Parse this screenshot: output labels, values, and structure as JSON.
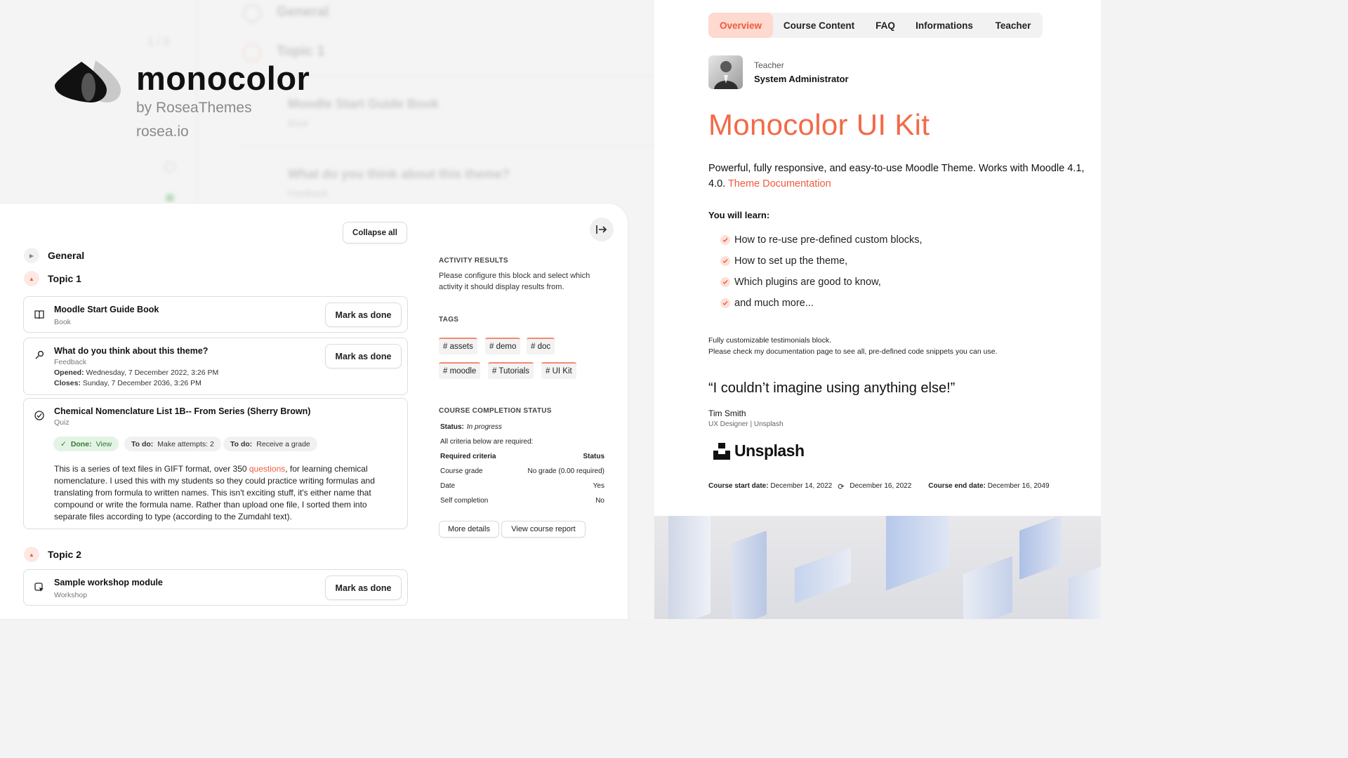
{
  "brand": {
    "name": "monocolor",
    "by": "by RoseaThemes",
    "site": "rosea.io"
  },
  "background_ghost": {
    "section_general": "General",
    "section_topic1": "Topic 1",
    "book_title": "Moodle Start Guide Book",
    "book_type": "Book",
    "feedback_title": "What do you think about this theme?",
    "feedback_type": "Feedback",
    "counter": "1 / 3"
  },
  "course_panel": {
    "collapse_all": "Collapse all",
    "sections": [
      {
        "title": "General"
      },
      {
        "title": "Topic 1"
      },
      {
        "title": "Topic 2"
      }
    ],
    "activities": [
      {
        "title": "Moodle Start Guide Book",
        "type": "Book",
        "button": "Mark as done",
        "icon": "book-icon"
      },
      {
        "title": "What do you think about this theme?",
        "type": "Feedback",
        "button": "Mark as done",
        "icon": "feedback-icon",
        "opened_label": "Opened:",
        "opened": "Wednesday, 7 December 2022, 3:26 PM",
        "closes_label": "Closes:",
        "closes": "Sunday, 7 December 2036, 3:26 PM"
      },
      {
        "title": "Chemical Nomenclature List 1B-- From Series (Sherry Brown)",
        "type": "Quiz",
        "icon": "quiz-icon",
        "badges": [
          {
            "label": "Done:",
            "value": "View"
          },
          {
            "label": "To do:",
            "value": "Make attempts: 2"
          },
          {
            "label": "To do:",
            "value": "Receive a grade"
          }
        ],
        "desc_part1": "This is a series of text files in GIFT format, over 350 ",
        "desc_link": "questions",
        "desc_part2": ", for learning chemical nomenclature. I used this with my students so they could practice writing formulas and translating from formula to written names. This isn't exciting stuff, it's either name that compound or write the formula name. Rather than upload one file, I sorted them into separate files according to type (according to the Zumdahl text)."
      },
      {
        "title": "Sample workshop module",
        "type": "Workshop",
        "button": "Mark as done",
        "icon": "workshop-icon"
      }
    ],
    "activity_results": {
      "heading": "ACTIVITY RESULTS",
      "text": "Please configure this block and select which activity it should display results from."
    },
    "tags": {
      "heading": "TAGS",
      "items": [
        "# assets",
        "# demo",
        "# doc",
        "# moodle",
        "# Tutorials",
        "# UI Kit"
      ]
    },
    "completion": {
      "heading": "COURSE COMPLETION STATUS",
      "status_label": "Status:",
      "status_value": "In progress",
      "required_text": "All criteria below are required:",
      "col_criteria": "Required criteria",
      "col_status": "Status",
      "rows": [
        {
          "criteria": "Course grade",
          "status": "No grade (0.00 required)"
        },
        {
          "criteria": "Date",
          "status": "Yes"
        },
        {
          "criteria": "Self completion",
          "status": "No"
        }
      ],
      "more_details": "More details",
      "view_report": "View course report"
    }
  },
  "overview": {
    "tabs": [
      "Overview",
      "Course Content",
      "FAQ",
      "Informations",
      "Teacher"
    ],
    "active_tab": "Overview",
    "teacher_role": "Teacher",
    "teacher_name": "System Administrator",
    "title": "Monocolor UI Kit",
    "desc": "Powerful, fully responsive, and easy-to-use Moodle Theme. Works with Moodle 4.1, 4.0. ",
    "desc_link": "Theme Documentation",
    "learn_heading": "You will learn:",
    "learn_items": [
      "How to re-use pre-defined custom blocks,",
      "How to set up the theme,",
      "Which plugins are good to know,",
      "and much more..."
    ],
    "testimonial_line1": "Fully customizable testimonials block.",
    "testimonial_line2": "Please check my documentation page to see all, pre-defined code snippets you can use.",
    "quote": "“I couldn’t imagine using anything else!”",
    "author_name": "Tim Smith",
    "author_role": "UX Designer | Unsplash",
    "company": "Unsplash",
    "start_label": "Course start date:",
    "start_date": "December 14, 2022",
    "updated_date": "December 16, 2022",
    "end_label": "Course end date:",
    "end_date": "December 16, 2049"
  },
  "colors": {
    "accent": "#f26a47",
    "accent_soft": "#fdd9cf",
    "done_green": "#2f7a3a"
  }
}
